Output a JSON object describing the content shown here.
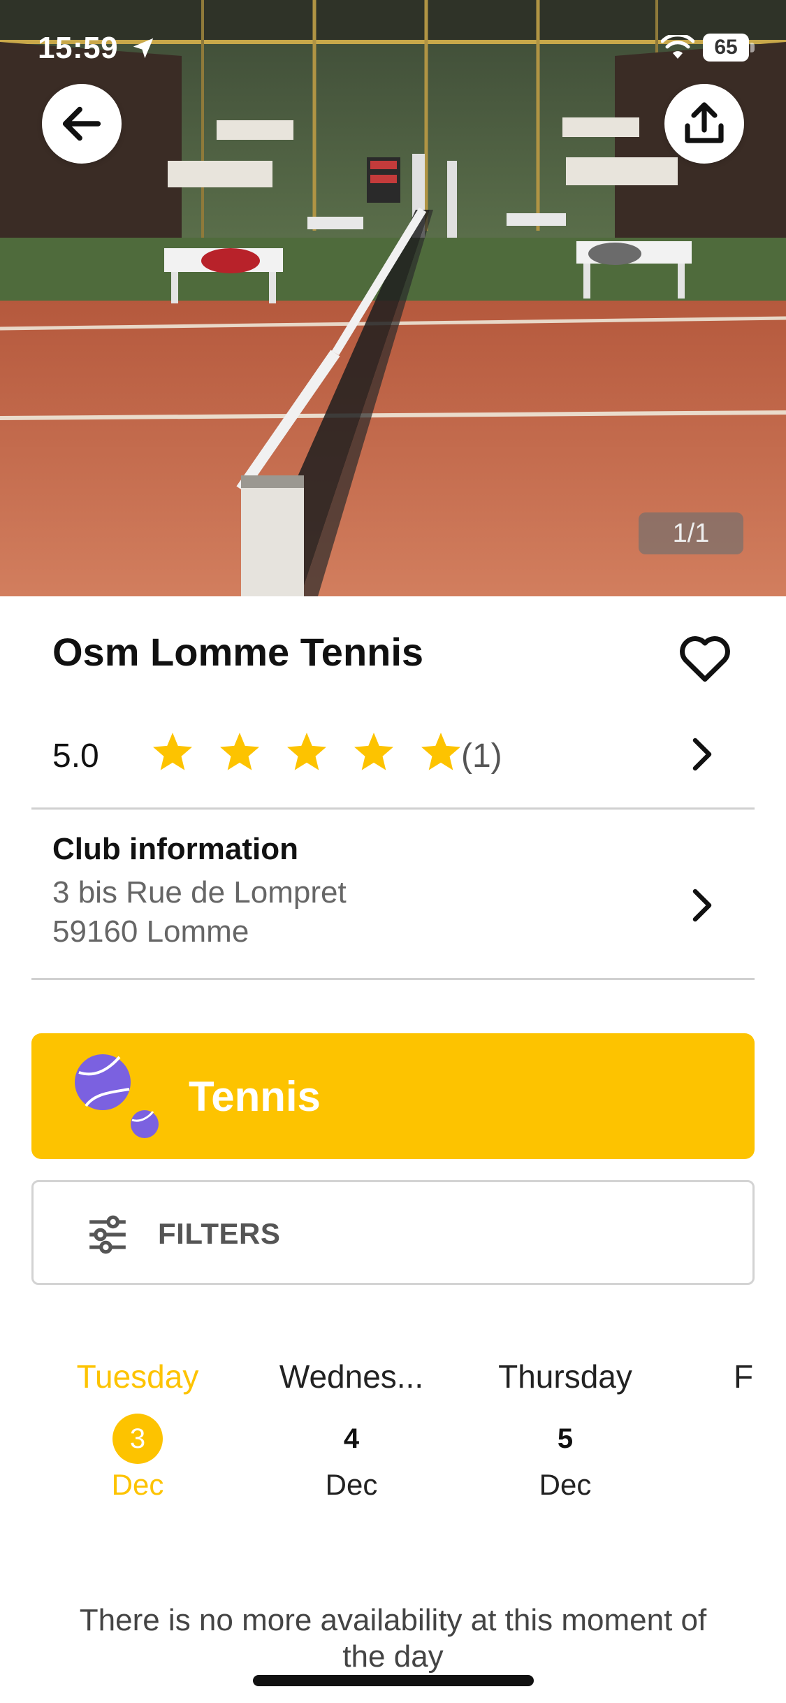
{
  "status_bar": {
    "time": "15:59",
    "battery": "65",
    "icons": [
      "location-arrow-icon",
      "wifi-icon",
      "battery-icon"
    ]
  },
  "hero": {
    "photo_counter": "1/1",
    "back_icon": "arrow-left-icon",
    "share_icon": "share-upload-icon"
  },
  "club": {
    "name": "Osm Lomme Tennis",
    "favorite_icon": "heart-outline-icon",
    "rating": {
      "value": "5.0",
      "stars_filled": 5,
      "stars_total": 5,
      "count": "(1)"
    },
    "info": {
      "title": "Club information",
      "address_line1": "3 bis Rue de Lompret",
      "address_line2": "59160 Lomme"
    }
  },
  "sport": {
    "label": "Tennis",
    "icon": "tennis-balls-icon"
  },
  "filters": {
    "label": "FILTERS",
    "icon": "sliders-icon"
  },
  "days": [
    {
      "name": "Tuesday",
      "number": "3",
      "month": "Dec",
      "selected": true
    },
    {
      "name": "Wednes...",
      "number": "4",
      "month": "Dec",
      "selected": false
    },
    {
      "name": "Thursday",
      "number": "5",
      "month": "Dec",
      "selected": false
    }
  ],
  "days_partial_label": "F",
  "availability_message": "There is no more availability at this moment of the day",
  "colors": {
    "accent": "#fdc300",
    "star": "#fdc300",
    "tennis_ball": "#7b61e0",
    "text_primary": "#111111",
    "text_secondary": "#666666"
  }
}
